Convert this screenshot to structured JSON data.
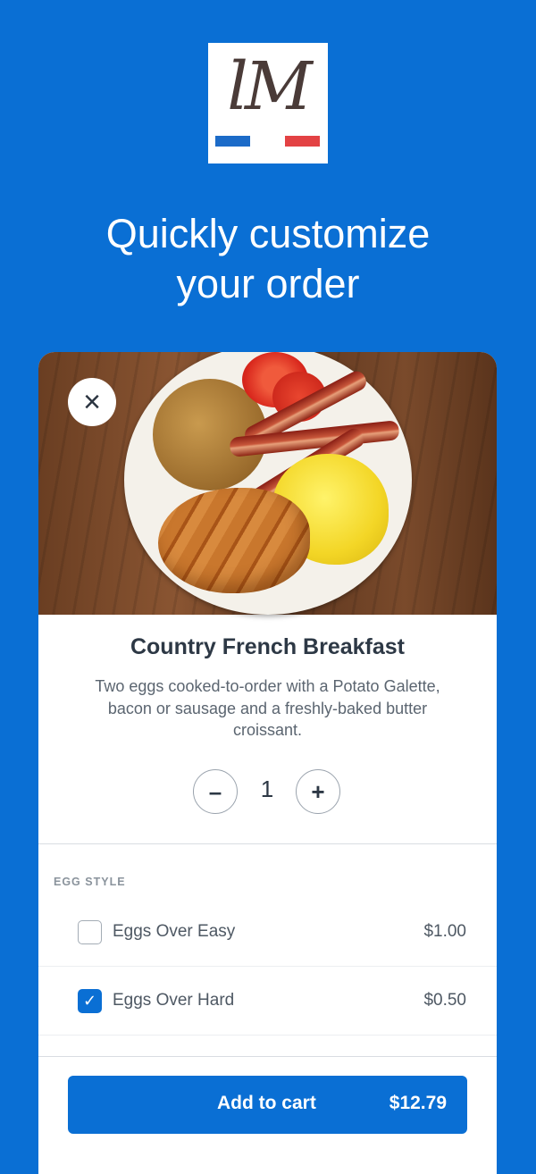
{
  "logo": {
    "text": "lM",
    "colors": {
      "blue": "#1c6bc8",
      "red": "#e34244"
    }
  },
  "headline": {
    "line1": "Quickly customize",
    "line2": "your order"
  },
  "item": {
    "title": "Country French Breakfast",
    "description": "Two eggs cooked-to-order with a Potato Galette, bacon or sausage and a freshly-baked butter croissant.",
    "close_icon": "×"
  },
  "quantity": {
    "minus": "–",
    "value": "1",
    "plus": "+"
  },
  "options": {
    "section_label": "EGG STYLE",
    "items": [
      {
        "label": "Eggs Over Easy",
        "price": "$1.00",
        "checked": false
      },
      {
        "label": "Eggs Over Hard",
        "price": "$0.50",
        "checked": true,
        "check_icon": "✓"
      }
    ]
  },
  "cart": {
    "label": "Add to cart",
    "price": "$12.79"
  },
  "colors": {
    "accent": "#0a6fd4",
    "text_dark": "#2d3845"
  }
}
